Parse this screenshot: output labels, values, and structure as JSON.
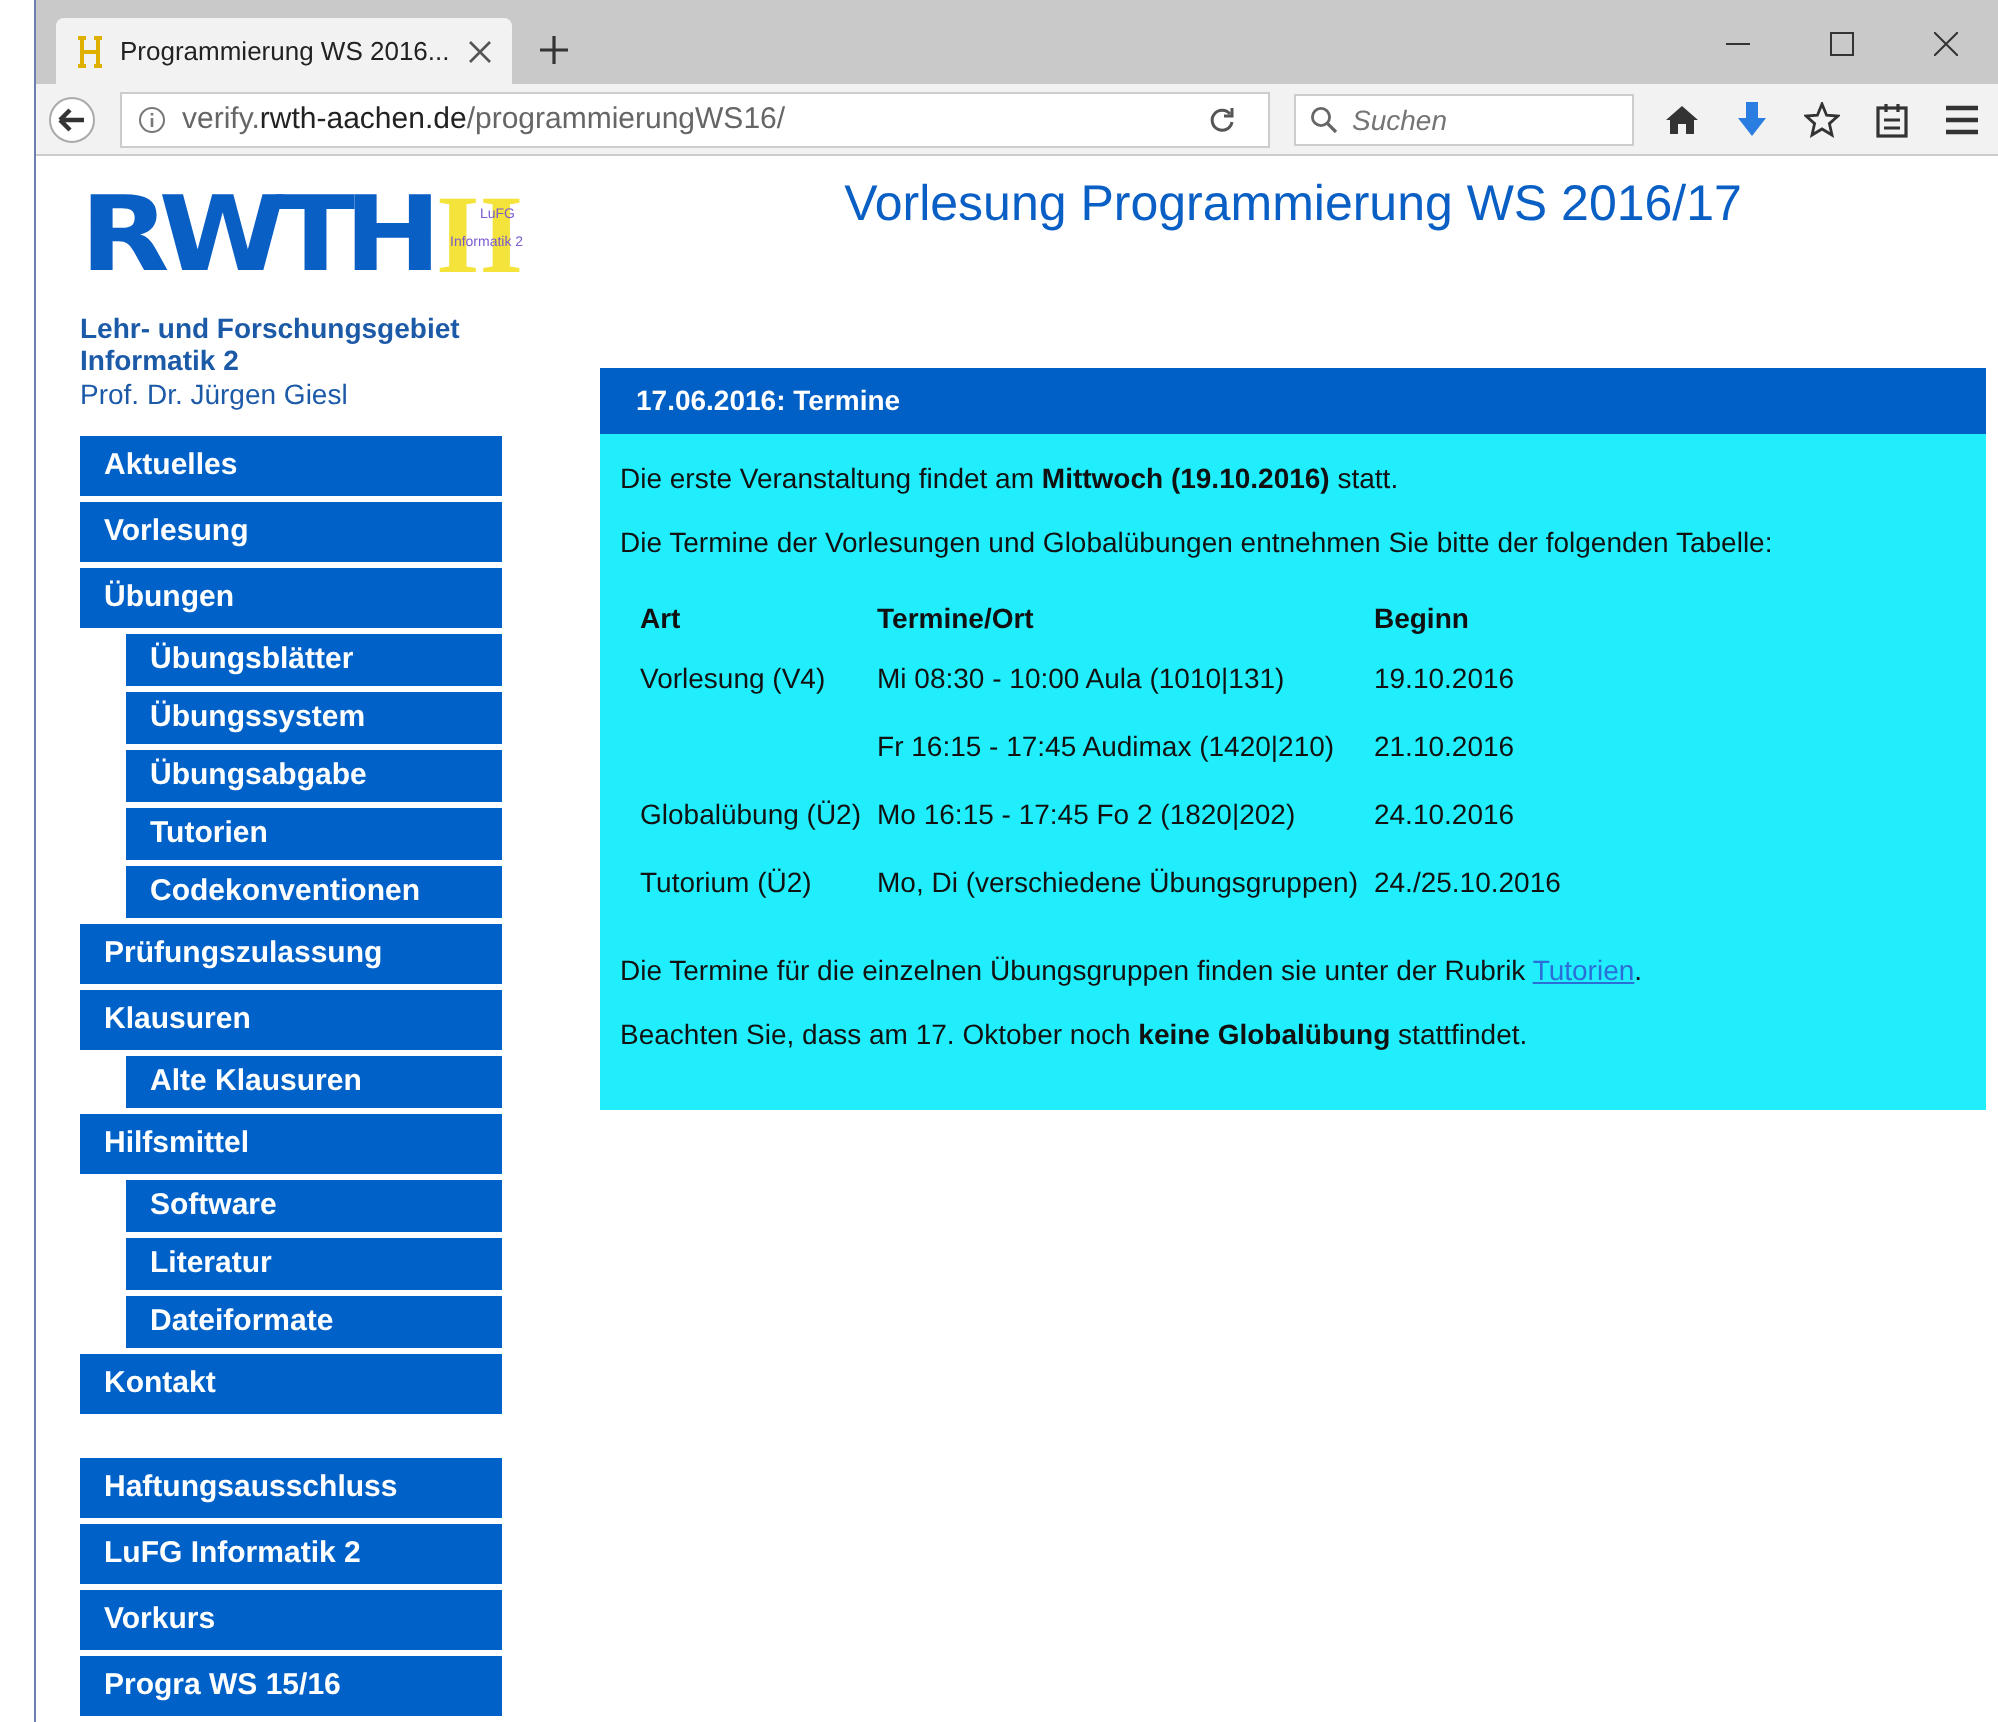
{
  "browser": {
    "tab_title": "Programmierung WS 2016...",
    "url_prefix": "verify.",
    "url_domain": "rwth-aachen.de",
    "url_path": "/programmierungWS16/",
    "search_placeholder": "Suchen"
  },
  "logo": {
    "main": "RWTH",
    "numeral": "II",
    "line_1": "LuFG",
    "line_2": "Informatik 2"
  },
  "institute": {
    "name_1": "Lehr- und Forschungsgebiet",
    "name_2": "Informatik 2",
    "professor": "Prof. Dr. Jürgen Giesl"
  },
  "page_title": "Vorlesung Programmierung WS 2016/17",
  "nav": [
    [
      {
        "label": "Aktuelles"
      },
      {
        "label": "Vorlesung"
      },
      {
        "label": "Übungen",
        "children": [
          {
            "label": "Übungsblätter"
          },
          {
            "label": "Übungssystem"
          },
          {
            "label": "Übungsabgabe"
          },
          {
            "label": "Tutorien"
          },
          {
            "label": "Codekonventionen"
          }
        ]
      },
      {
        "label": "Prüfungszulassung"
      },
      {
        "label": "Klausuren",
        "children": [
          {
            "label": "Alte Klausuren"
          }
        ]
      },
      {
        "label": "Hilfsmittel",
        "children": [
          {
            "label": "Software"
          },
          {
            "label": "Literatur"
          },
          {
            "label": "Dateiformate"
          }
        ]
      },
      {
        "label": "Kontakt"
      }
    ],
    [
      {
        "label": "Haftungsausschluss"
      },
      {
        "label": "LuFG Informatik 2"
      },
      {
        "label": "Vorkurs"
      },
      {
        "label": "Progra WS 15/16"
      }
    ]
  ],
  "news": {
    "title": "17.06.2016: Termine",
    "intro": [
      "Die erste Veranstaltung findet am **Mittwoch (19.10.2016)** statt.",
      "Die Termine der Vorlesungen und Globalübungen entnehmen Sie bitte der folgenden Tabelle:"
    ],
    "table": {
      "columns": [
        "Art",
        "Termine/Ort",
        "Beginn"
      ],
      "rows": [
        [
          "Vorlesung (V4)",
          "Mi 08:30 - 10:00 Aula (1010|131)",
          "19.10.2016"
        ],
        [
          "",
          "Fr 16:15 - 17:45 Audimax (1420|210)",
          "21.10.2016"
        ],
        [
          "Globalübung (Ü2)",
          "Mo 16:15 - 17:45 Fo 2 (1820|202)",
          "24.10.2016"
        ],
        [
          "Tutorium (Ü2)",
          "Mo, Di (verschiedene Übungsgruppen)",
          "24./25.10.2016"
        ]
      ]
    },
    "link_sentence": {
      "before": "Die Termine für die einzelnen Übungsgruppen finden sie unter der Rubrik ",
      "link": "Tutorien",
      "after": "."
    },
    "closing": "Beachten Sie, dass am 17. Oktober noch **keine Globalübung** stattfindet."
  }
}
